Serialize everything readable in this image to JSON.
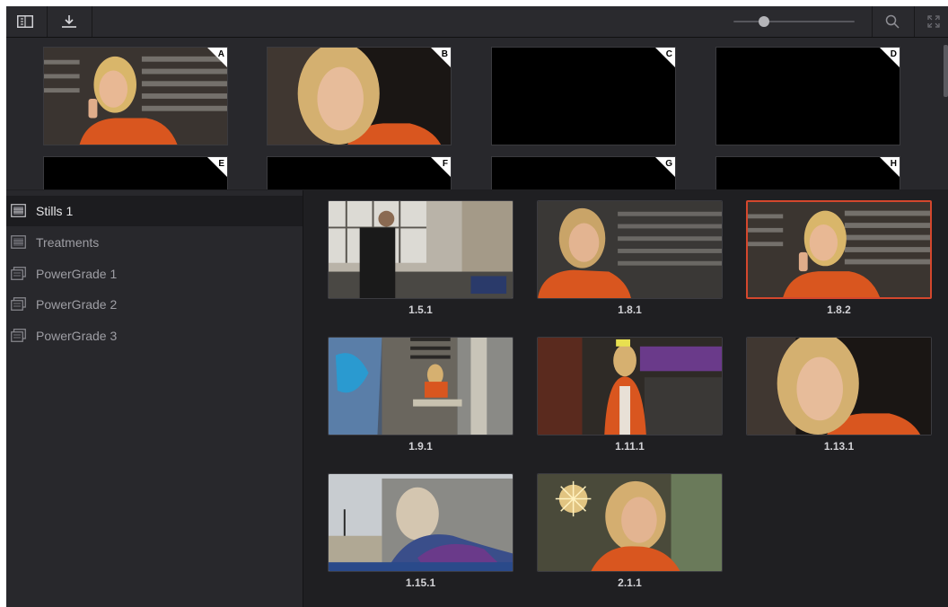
{
  "toolbar": {
    "sidebar_toggle_icon": "sidebar-panel-icon",
    "import_icon": "download-tray-icon",
    "zoom_slider_level": 0.25,
    "search_icon": "search-icon",
    "fullscreen_icon": "expand-icon"
  },
  "memories": {
    "slots": [
      {
        "letter": "A",
        "content": "woman-phone"
      },
      {
        "letter": "B",
        "content": "woman-closeup"
      },
      {
        "letter": "C",
        "content": "empty"
      },
      {
        "letter": "D",
        "content": "empty"
      },
      {
        "letter": "E",
        "content": "empty"
      },
      {
        "letter": "F",
        "content": "empty"
      },
      {
        "letter": "G",
        "content": "empty"
      },
      {
        "letter": "H",
        "content": "empty"
      }
    ]
  },
  "albums": [
    {
      "label": "Stills 1",
      "icon": "stills-album-icon",
      "active": true
    },
    {
      "label": "Treatments",
      "icon": "stills-album-icon",
      "active": false
    },
    {
      "label": "PowerGrade 1",
      "icon": "powergrade-album-icon",
      "active": false
    },
    {
      "label": "PowerGrade 2",
      "icon": "powergrade-album-icon",
      "active": false
    },
    {
      "label": "PowerGrade 3",
      "icon": "powergrade-album-icon",
      "active": false
    }
  ],
  "stills": [
    {
      "label": "1.5.1",
      "selected": false
    },
    {
      "label": "1.8.1",
      "selected": false
    },
    {
      "label": "1.8.2",
      "selected": true
    },
    {
      "label": "1.9.1",
      "selected": false
    },
    {
      "label": "1.11.1",
      "selected": false
    },
    {
      "label": "1.13.1",
      "selected": false
    },
    {
      "label": "1.15.1",
      "selected": false
    },
    {
      "label": "2.1.1",
      "selected": false
    }
  ],
  "colors": {
    "selection": "#d4472d",
    "orange_jacket": "#d9561f"
  }
}
